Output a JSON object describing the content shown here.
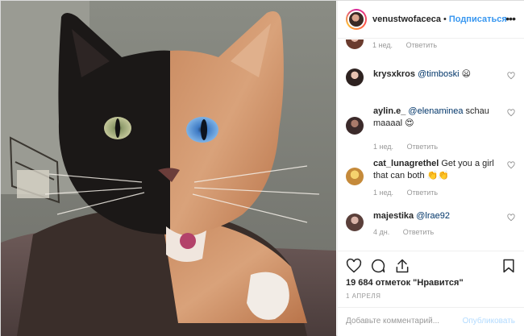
{
  "post": {
    "username": "venustwofaceca",
    "separator": "•",
    "follow_label": "Подписаться",
    "more_label": "•••"
  },
  "top_comment": {
    "time": "1 нед.",
    "reply_label": "Ответить"
  },
  "comments": [
    {
      "user": "krysxkros",
      "mention": "@timboski",
      "text": "",
      "emoji": "😦",
      "time": "",
      "reply_label": ""
    },
    {
      "user": "aylin.e_",
      "mention": "@elenaminea",
      "text": "schau maaaal",
      "emoji": "😍",
      "time": "1 нед.",
      "reply_label": "Ответить"
    },
    {
      "user": "cat_lunagrethel",
      "mention": "",
      "text": "Get you a girl that can both",
      "emoji": "👏👏",
      "time": "1 нед.",
      "reply_label": "Ответить"
    },
    {
      "user": "majestika",
      "mention": "@lrae92",
      "text": "",
      "emoji": "",
      "time": "4 дн.",
      "reply_label": "Ответить"
    }
  ],
  "likes_text": "19 684 отметок \"Нравится\"",
  "date_text": "1 АПРЕЛЯ",
  "comment_placeholder": "Добавьте комментарий...",
  "publish_label": "Опубликовать",
  "icons": [
    "heart-icon",
    "comment-icon",
    "share-icon",
    "bookmark-icon",
    "more-icon"
  ]
}
